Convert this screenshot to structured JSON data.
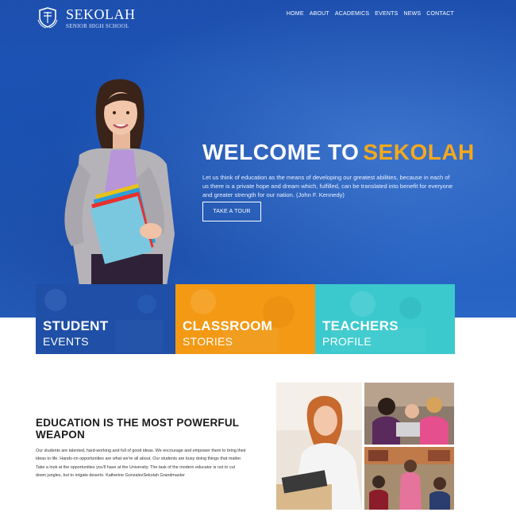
{
  "header": {
    "brand": "SEKOLAH",
    "tagline": "SENIOR HIGH SCHOOL",
    "logo_icon": "shield-crest-icon",
    "nav": [
      "HOME",
      "ABOUT",
      "ACADEMICS",
      "EVENTS",
      "NEWS",
      "CONTACT"
    ]
  },
  "hero": {
    "title_white": "WELCOME TO",
    "title_accent": "SEKOLAH",
    "accent_color": "#f5a91b",
    "text": "Let us think of education as the means of developing our greatest abilities, because in each of us there is a private hope and dream which, fulfilled, can be translated into benefit for everyone and greater strength for our nation. (John F. Kennedy)",
    "button": "TAKE A TOUR"
  },
  "tiles": [
    {
      "title": "STUDENT",
      "subtitle": "EVENTS",
      "color": "#1f4fa6"
    },
    {
      "title": "CLASSROOM",
      "subtitle": "STORIES",
      "color": "#f39914"
    },
    {
      "title": "TEACHERS",
      "subtitle": "PROFILE",
      "color": "#3cc9cd"
    }
  ],
  "education": {
    "title": "EDUCATION IS THE MOST POWERFUL WEAPON",
    "text": "Our students are talented, hard-working and full of good ideas. We encourage and empower them to bring their ideas to life. Hands-on opportunities are what we're all about. Our students are busy doing things that matter. Take a look at the opportunities you'll have at the University. The task of the modern educator is not to cut down jungles, but to irrigate deserts. Katherine GonzalezSekolah Grandmaster"
  }
}
